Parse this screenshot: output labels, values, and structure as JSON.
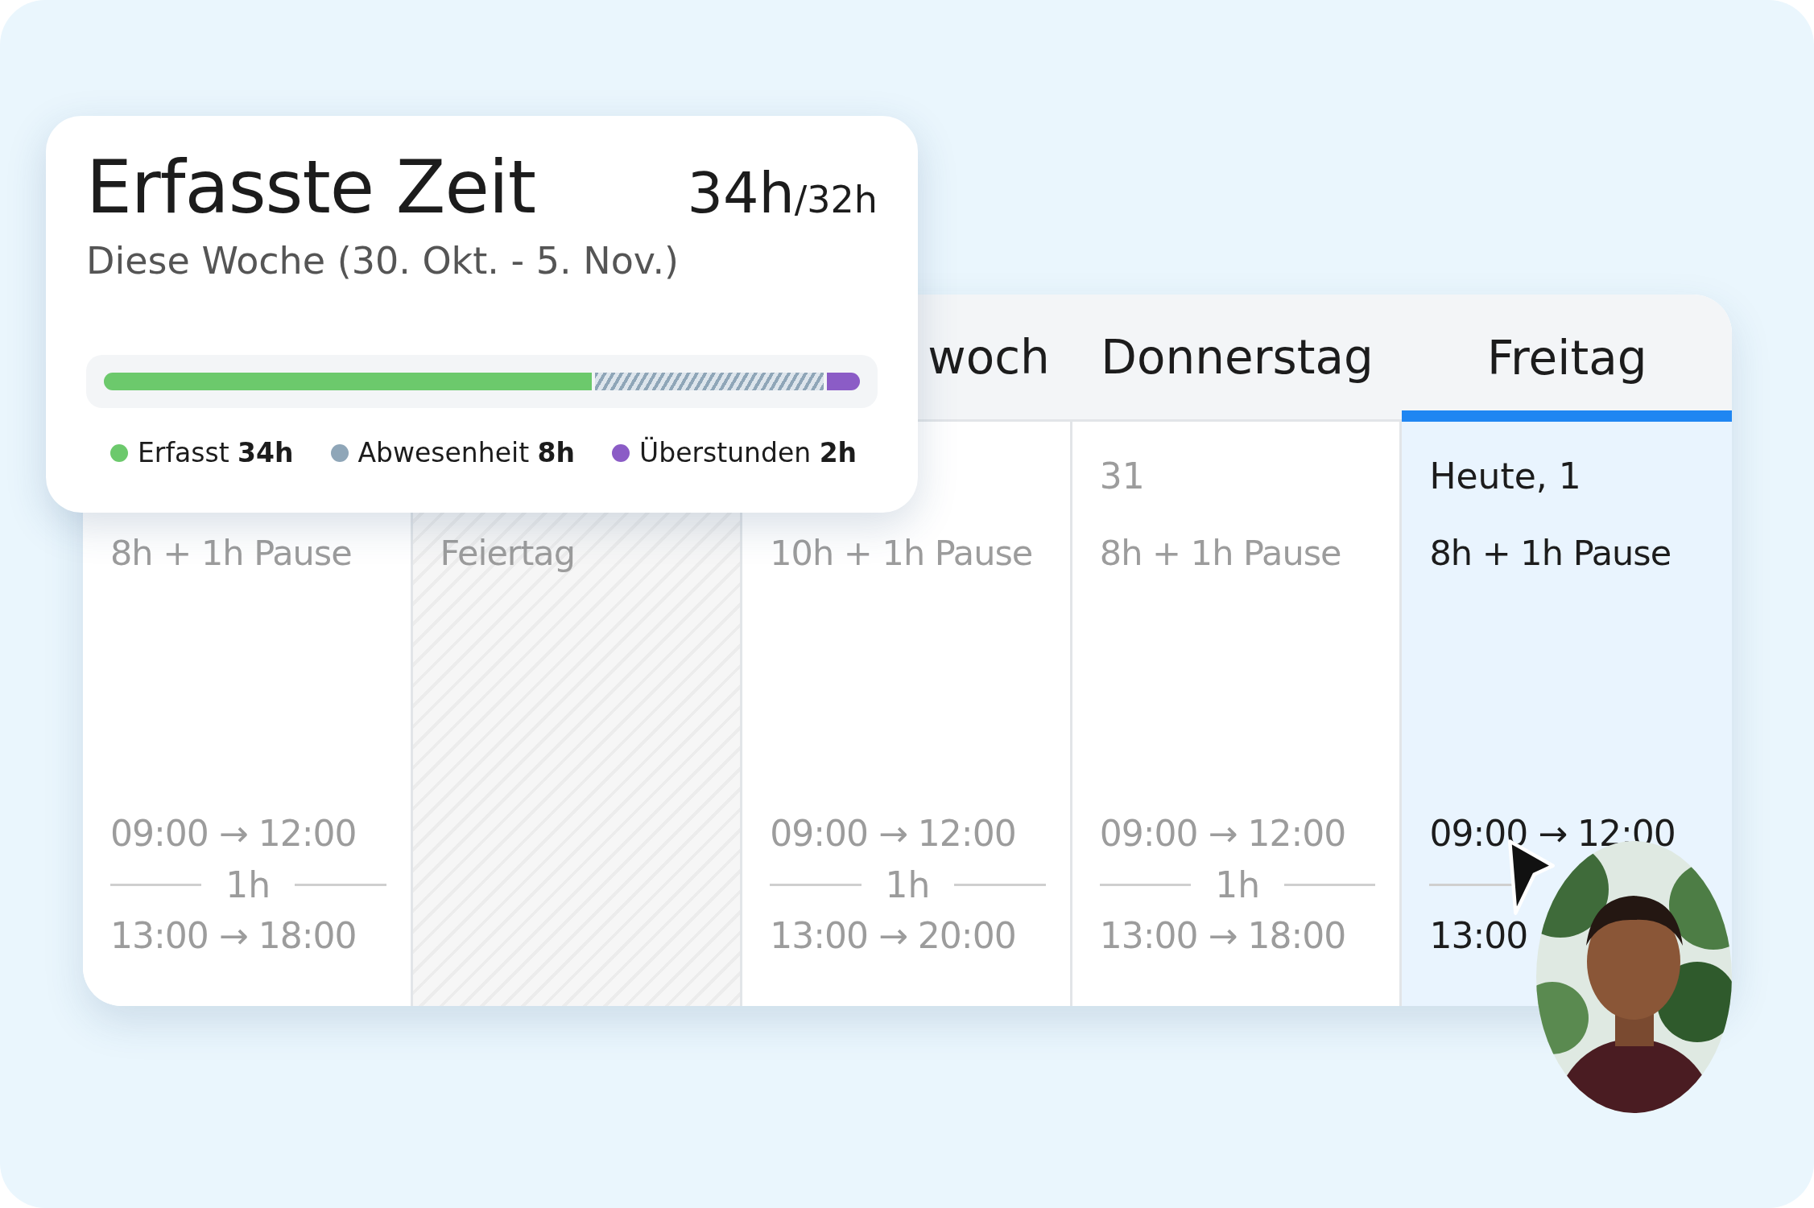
{
  "summary": {
    "title": "Erfasste Zeit",
    "total": "34h",
    "target": "/32h",
    "subtitle": "Diese Woche (30. Okt. - 5. Nov.)",
    "segments": [
      {
        "kind": "logged",
        "level": 0.645,
        "color": "#6cc96c"
      },
      {
        "kind": "absence",
        "color": "#8fa6b8"
      },
      {
        "kind": "overtime",
        "color": "#8b5cc6"
      }
    ],
    "legend": [
      {
        "label": "Erfasst",
        "value": "34h",
        "color": "#6cc96c"
      },
      {
        "label": "Abwesenheit",
        "value": "8h",
        "color": "#8fa6b8"
      },
      {
        "label": "Überstunden",
        "value": "2h",
        "color": "#8b5cc6"
      }
    ]
  },
  "days": [
    {
      "kind": "work",
      "today": false,
      "hours": "8h + 1h Pause",
      "morning": "09:00 → 12:00",
      "break": "1h",
      "afternoon": "13:00 → 18:00"
    },
    {
      "kind": "holiday",
      "today": false,
      "hours": "Feiertag"
    },
    {
      "header": "woch",
      "kind": "work",
      "today": false,
      "hours": "10h + 1h Pause",
      "morning": "09:00 → 12:00",
      "break": "1h",
      "afternoon": "13:00 → 20:00"
    },
    {
      "header": "Donnerstag",
      "date": "31",
      "kind": "work",
      "today": false,
      "hours": "8h + 1h Pause",
      "morning": "09:00 → 12:00",
      "break": "1h",
      "afternoon": "13:00 → 18:00"
    },
    {
      "header": "Freitag",
      "date": "Heute, 1",
      "kind": "work",
      "today": true,
      "hours": "8h + 1h Pause",
      "morning": "09:00 → 12:00",
      "afternoon": "13:00"
    }
  ]
}
